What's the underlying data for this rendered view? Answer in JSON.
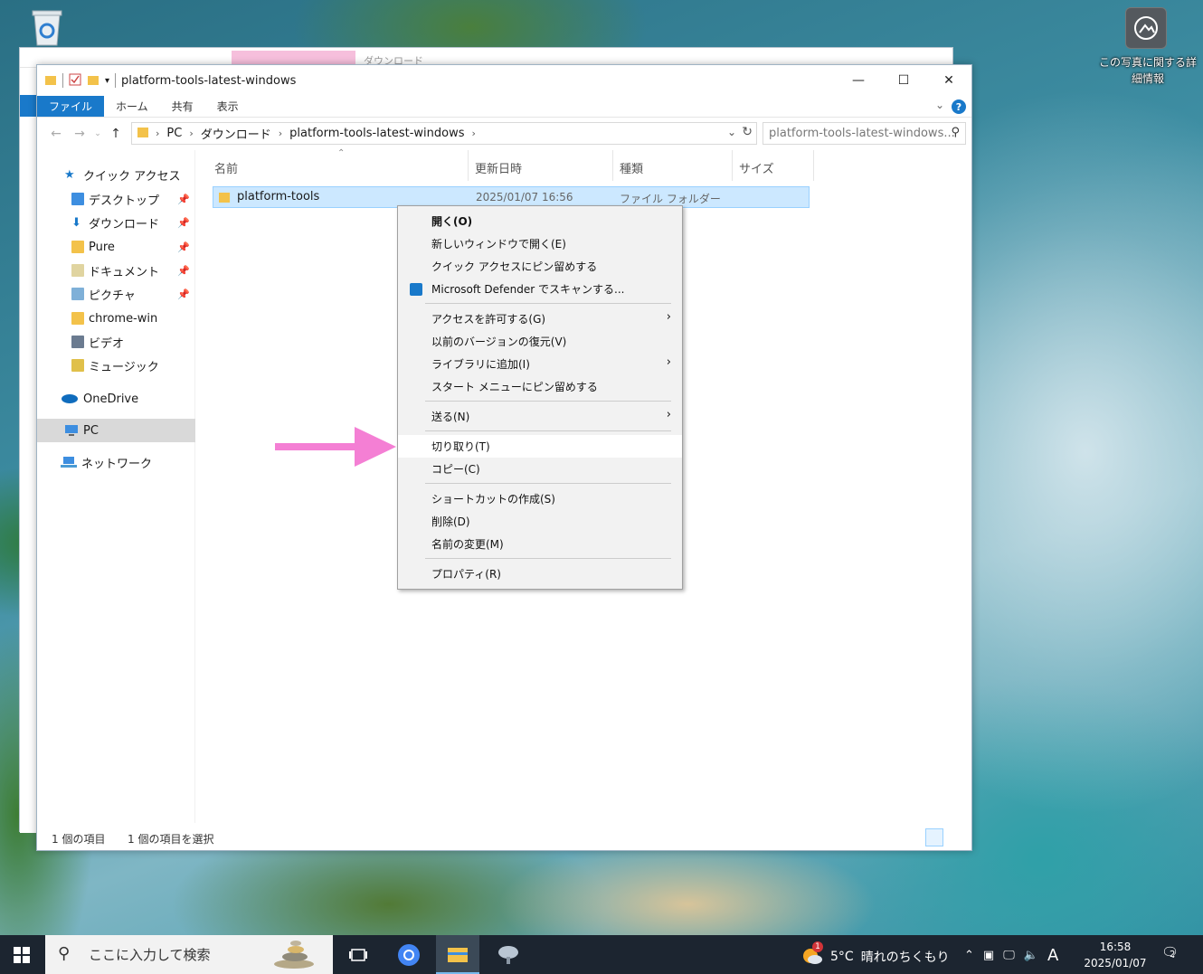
{
  "desktop": {
    "user_tile_text": "この写真に関する詳細情報"
  },
  "bg_window": {
    "tab_label": "ダウンロード"
  },
  "window": {
    "title": "platform-tools-latest-windows",
    "minimize": "—",
    "maximize": "☐",
    "close": "✕"
  },
  "ribbon": {
    "tabs": [
      "ファイル",
      "ホーム",
      "共有",
      "表示"
    ],
    "help": "?"
  },
  "address": {
    "crumbs": [
      "PC",
      "ダウンロード",
      "platform-tools-latest-windows"
    ],
    "search_placeholder": "platform-tools-latest-windows..."
  },
  "nav": {
    "items": [
      {
        "label": "クイック アクセス",
        "icon": "star-icon"
      },
      {
        "label": "デスクトップ",
        "icon": "desktop-folder-icon",
        "pinned": true
      },
      {
        "label": "ダウンロード",
        "icon": "download-folder-icon",
        "pinned": true
      },
      {
        "label": "Pure",
        "icon": "folder-icon",
        "pinned": true
      },
      {
        "label": "ドキュメント",
        "icon": "documents-folder-icon",
        "pinned": true
      },
      {
        "label": "ピクチャ",
        "icon": "pictures-folder-icon",
        "pinned": true
      },
      {
        "label": "chrome-win",
        "icon": "folder-icon"
      },
      {
        "label": "ビデオ",
        "icon": "videos-folder-icon"
      },
      {
        "label": "ミュージック",
        "icon": "music-folder-icon"
      },
      {
        "label": "OneDrive",
        "icon": "cloud-icon"
      },
      {
        "label": "PC",
        "icon": "pc-icon"
      },
      {
        "label": "ネットワーク",
        "icon": "network-icon"
      }
    ]
  },
  "columns": {
    "name": "名前",
    "date": "更新日時",
    "type": "種類",
    "size": "サイズ"
  },
  "files": [
    {
      "name": "platform-tools",
      "date": "2025/01/07 16:56",
      "type": "ファイル フォルダー"
    }
  ],
  "context_menu": {
    "items": [
      "開く(O)",
      "新しいウィンドウで開く(E)",
      "クイック アクセスにピン留めする",
      "Microsoft Defender でスキャンする...",
      "アクセスを許可する(G)",
      "以前のバージョンの復元(V)",
      "ライブラリに追加(I)",
      "スタート メニューにピン留めする",
      "送る(N)",
      "切り取り(T)",
      "コピー(C)",
      "ショートカットの作成(S)",
      "削除(D)",
      "名前の変更(M)",
      "プロパティ(R)"
    ],
    "arrow_color": "#f47fd4"
  },
  "status": {
    "count": "1 個の項目",
    "selected": "1 個の項目を選択"
  },
  "taskbar": {
    "search_placeholder": "ここに入力して検索",
    "weather_temp": "5°C",
    "weather_text": "晴れのちくもり",
    "weather_badge": "1",
    "ime": "A",
    "time": "16:58",
    "date": "2025/01/07",
    "notif_count": "2"
  }
}
